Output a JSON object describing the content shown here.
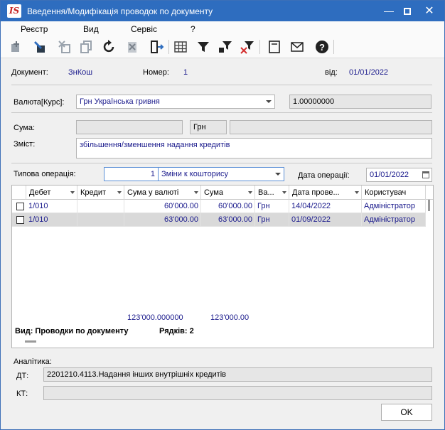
{
  "window": {
    "app_logo": "IS",
    "title": "Введення/Модифікація проводок по документу"
  },
  "menu": [
    "Реєстр",
    "Вид",
    "Сервіс",
    "?"
  ],
  "toolbar_icons": [
    "add-entry-icon",
    "edit-entry-icon",
    "delete-entry-icon",
    "copy-icon",
    "refresh-icon",
    "delete-file-icon",
    "exit-icon",
    "grid-icon",
    "filter-icon",
    "filter-set-icon",
    "filter-clear-icon",
    "document-icon",
    "mail-icon",
    "help-icon"
  ],
  "document": {
    "doc_label": "Документ:",
    "doc_value": "ЗнКош",
    "number_label": "Номер:",
    "number_value": "1",
    "date_label": "від:",
    "date_value": "01/01/2022"
  },
  "currency": {
    "label": "Валюта[Курс]:",
    "value": "Грн Українська гривня",
    "rate": "1.00000000"
  },
  "amount": {
    "label": "Сума:",
    "value": "",
    "currency": "Грн",
    "value2": ""
  },
  "content": {
    "label": "Зміст:",
    "value": "збільшення/зменшення надання кредитів"
  },
  "operation": {
    "label": "Типова операція:",
    "code": "1",
    "name": "Зміни к кошторису",
    "date_label": "Дата операції:",
    "date_value": "01/01/2022"
  },
  "grid": {
    "columns": [
      "Дебет",
      "Кредит",
      "Сума у валюті",
      "Сума",
      "Ва...",
      "Дата прове...",
      "Користувач"
    ],
    "rows": [
      {
        "debit": "1/010",
        "credit": "",
        "sum_currency": "60'000.00",
        "sum": "60'000.00",
        "currency": "Грн",
        "date": "14/04/2022",
        "user": "Адміністратор",
        "selected": false
      },
      {
        "debit": "1/010",
        "credit": "",
        "sum_currency": "63'000.00",
        "sum": "63'000.00",
        "currency": "Грн",
        "date": "01/09/2022",
        "user": "Адміністратор",
        "selected": true
      }
    ],
    "total_sum_currency": "123'000.000000",
    "total_sum": "123'000.00",
    "view_label": "Вид: Проводки по документу",
    "rows_label": "Рядків: 2"
  },
  "analytics": {
    "label": "Аналітика:",
    "dt_label": "ДТ:",
    "dt_value": "2201210.4113.Надання інших внутрішніх кредитів",
    "kt_label": "КТ:",
    "kt_value": ""
  },
  "ok_label": "OK"
}
